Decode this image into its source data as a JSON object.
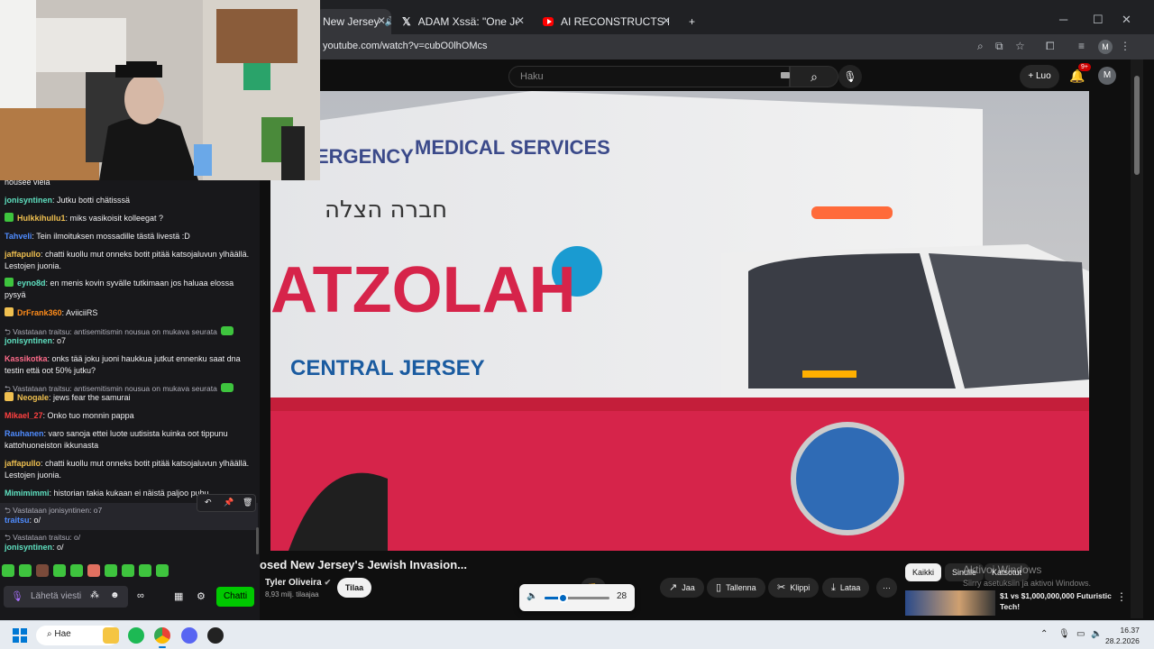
{
  "browser": {
    "tabs": [
      {
        "label": "New Jersey",
        "icon": "speaker-icon"
      },
      {
        "label": "ADAM Xssä: \"One Jewish Zioni",
        "icon": "x-logo-icon"
      },
      {
        "label": "AI RECONSTRUCTS HITLER'S SP",
        "icon": "youtube-icon"
      }
    ],
    "new_tab": "+",
    "url": "youtube.com/watch?v=cubO0lhOMcs",
    "profile_initial": "M"
  },
  "youtube": {
    "search_placeholder": "Haku",
    "create_label": "Luo",
    "notifications_badge": "9+",
    "avatar_initial": "M",
    "video_title": "osed New Jersey's Jewish Invasion...",
    "channel_name": "Tyler Oliveira",
    "subscribers": "8,93 milj. tilaajaa",
    "subscribe_label": "Tilaa",
    "actions": {
      "share": "Jaa",
      "save": "Tallenna",
      "clip": "Klippi",
      "download": "Lataa"
    },
    "chips": [
      "Kaikki",
      "Sinulle",
      "Katsotut"
    ],
    "recommendation_title": "$1 vs $1,000,000,000 Futuristic Tech!",
    "video_text": {
      "hebrew": "חברה הצלה",
      "agency": "ERGENCY",
      "services": "MEDICAL SERVICES",
      "brand": "ATZOLAH",
      "region": "CENTRAL JERSEY"
    }
  },
  "windows_activation": {
    "title": "Aktivoi Windows",
    "subtitle": "Siirry asetuksiin ja aktivoi Windows."
  },
  "volume": {
    "value": "28",
    "level": 0.28
  },
  "chat": {
    "messages": [
      {
        "user": "",
        "text": "nousee vielä",
        "color": "#efeff1"
      },
      {
        "user": "jonisyntinen",
        "text": ": Jutku botti chätisssä",
        "color": "#5fe0c0"
      },
      {
        "user": "Hulkkihullu1",
        "text": ": miks vasikoisit kolleegat ?",
        "color": "#f0c050"
      },
      {
        "user": "Tahveli",
        "text": ": Tein ilmoituksen mossadille tästä livestä :D",
        "color": "#4f8cff"
      },
      {
        "user": "jaffapullo",
        "text": ": chatti kuollu mut onneks botit pitää katsojaluvun ylhäällä. Lestojen juonia.",
        "color": "#f0c050"
      },
      {
        "user": "eyno8d",
        "text": ": en menis kovin syvälle tutkimaan jos haluaa elossa pysyä",
        "color": "#5fe0c0"
      },
      {
        "user": "DrFrank360",
        "text": ": AviiciiRS",
        "color": "#ff8c1a"
      },
      {
        "user": "jonisyntinen",
        "text": ": o7",
        "color": "#5fe0c0"
      },
      {
        "user": "Kassikotka",
        "text": ": onks tää joku juoni haukkua jutkut ennenku saat dna testin että oot 50% jutku?",
        "color": "#ff6b8a"
      },
      {
        "user": "Neogale",
        "text": ": jews fear the samurai",
        "color": "#f0c050"
      },
      {
        "user": "Mikael_27",
        "text": ": Onko tuo monnin pappa",
        "color": "#ff4040"
      },
      {
        "user": "Rauhanen",
        "text": ": varo sanoja ettei luote uutisista kuinka oot tippunu kattohuoneiston ikkunasta",
        "color": "#4f8cff"
      },
      {
        "user": "jaffapullo",
        "text": ": chatti kuollu mut onneks botit pitää katsojaluvun ylhäällä. Lestojen juonia.",
        "color": "#f0c050"
      },
      {
        "user": "Mimimimmi",
        "text": ": historian takia kukaan ei näistä paljoo puhu",
        "color": "#5fe0c0"
      },
      {
        "user": "traitsu",
        "text": ": o/",
        "color": "#4f8cff"
      },
      {
        "user": "jonisyntinen",
        "text": ": o/",
        "color": "#5fe0c0"
      }
    ],
    "replies": [
      "Vastataan traitsu: antisemitismin nousua on mukava seurata",
      "Vastataan traitsu: antisemitismin nousua on mukava seurata",
      "Vastataan jonisyntinen: o7",
      "Vastataan traitsu: o/"
    ],
    "input_placeholder": "Lähetä viesti",
    "send_label": "Chatti"
  },
  "taskbar": {
    "search_label": "Hae",
    "time": "16.37",
    "date": "28.2.2026"
  }
}
